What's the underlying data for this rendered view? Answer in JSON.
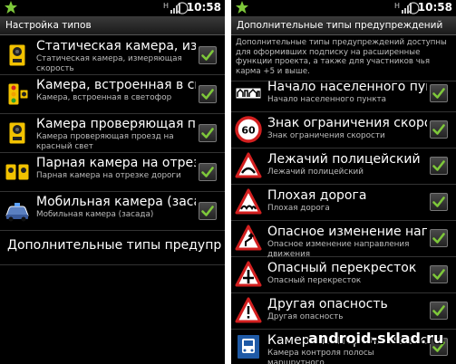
{
  "status": {
    "time": "10:58",
    "signal_label": "H",
    "battery": "83"
  },
  "left": {
    "title": "Настройка типов",
    "items": [
      {
        "title": "Статическая камера, измеряющая",
        "sub": "Статическая камера, измеряющая скорость",
        "checked": true,
        "icon": "camera-icon"
      },
      {
        "title": "Камера, встроенная в светофор",
        "sub": "Камера, встроенная в светофор",
        "checked": true,
        "icon": "traffic-light-camera-icon"
      },
      {
        "title": "Камера проверяющая проезд на красный",
        "sub": "Камера проверяющая проезд на красный свет",
        "checked": true,
        "icon": "camera-icon"
      },
      {
        "title": "Парная камера на отрезке дороги",
        "sub": "Парная камера на отрезке дороги",
        "checked": true,
        "icon": "double-camera-icon"
      },
      {
        "title": "Мобильная камера (засада)",
        "sub": "Мобильная камера (засада)",
        "checked": true,
        "icon": "police-car-icon"
      }
    ],
    "more_label": "Дополнительные типы предупреждений"
  },
  "right": {
    "title": "Дополнительные типы предупреждений",
    "description": "Дополнительные типы предупреждений доступны для оформивших подписку на расширенные функции проекта, а также для участников чья карма +5 и выше.",
    "items": [
      {
        "title": "Начало населенного пункта",
        "sub": "Начало населенного пункта",
        "checked": true,
        "icon": "settlement-sign-icon"
      },
      {
        "title": "Знак ограничения скорости",
        "sub": "Знак ограничения скорости",
        "checked": true,
        "icon": "speed-limit-sign-icon",
        "sign_text": "60"
      },
      {
        "title": "Лежачий полицейский",
        "sub": "Лежачий полицейский",
        "checked": true,
        "icon": "speed-bump-sign-icon"
      },
      {
        "title": "Плохая дорога",
        "sub": "Плохая дорога",
        "checked": true,
        "icon": "bad-road-sign-icon"
      },
      {
        "title": "Опасное изменение направления",
        "sub": "Опасное изменение направления движения",
        "checked": true,
        "icon": "dangerous-turn-sign-icon"
      },
      {
        "title": "Опасный перекресток",
        "sub": "Опасный перекресток",
        "checked": true,
        "icon": "crossroad-sign-icon"
      },
      {
        "title": "Другая опасность",
        "sub": "Другая опасность",
        "checked": true,
        "icon": "danger-sign-icon"
      },
      {
        "title": "Камера контроля полосы",
        "sub": "Камера контроля полосы маршрутного",
        "checked": true,
        "icon": "bus-lane-camera-icon"
      }
    ]
  },
  "watermark": "android-sklad.ru",
  "colors": {
    "accent_green": "#7ec83a",
    "sign_red": "#d21f1f",
    "camera_yellow": "#f2c200"
  }
}
